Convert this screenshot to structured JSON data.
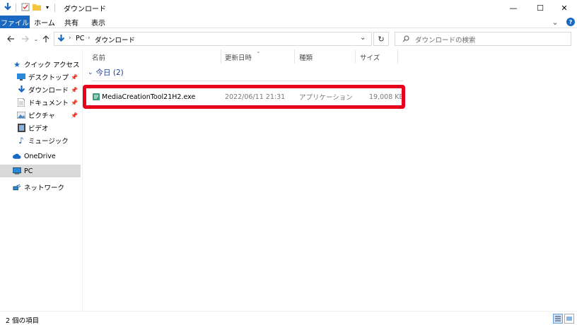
{
  "titlebar": {
    "title": "ダウンロード",
    "minimize": "—",
    "maximize": "☐",
    "close": "✕"
  },
  "ribbon": {
    "tabs": [
      "ファイル",
      "ホーム",
      "共有",
      "表示"
    ],
    "expand": "⌄",
    "help": "?"
  },
  "address": {
    "path": [
      "PC",
      "ダウンロード"
    ],
    "search_placeholder": "ダウンロードの検索"
  },
  "sidebar": {
    "quick_access": "クイック アクセス",
    "items": [
      {
        "label": "デスクトップ",
        "pinned": true
      },
      {
        "label": "ダウンロード",
        "pinned": true
      },
      {
        "label": "ドキュメント",
        "pinned": true
      },
      {
        "label": "ピクチャ",
        "pinned": true
      },
      {
        "label": "ビデオ",
        "pinned": false
      },
      {
        "label": "ミュージック",
        "pinned": false
      }
    ],
    "onedrive": "OneDrive",
    "pc": "PC",
    "network": "ネットワーク",
    "pin_glyph": "📌"
  },
  "columns": {
    "name": "名前",
    "date": "更新日時",
    "type": "種類",
    "size": "サイズ"
  },
  "group": {
    "label": "今日 (2)"
  },
  "files": [
    {
      "name": "MediaCreationTool21H2.exe",
      "date": "2022/06/11 21:31",
      "type": "アプリケーション",
      "size": "19,008 KB"
    }
  ],
  "status": {
    "count": "2 個の項目"
  },
  "colors": {
    "accent": "#1a68c0",
    "highlight": "#e8001c",
    "group_header": "#1e3d8f"
  }
}
